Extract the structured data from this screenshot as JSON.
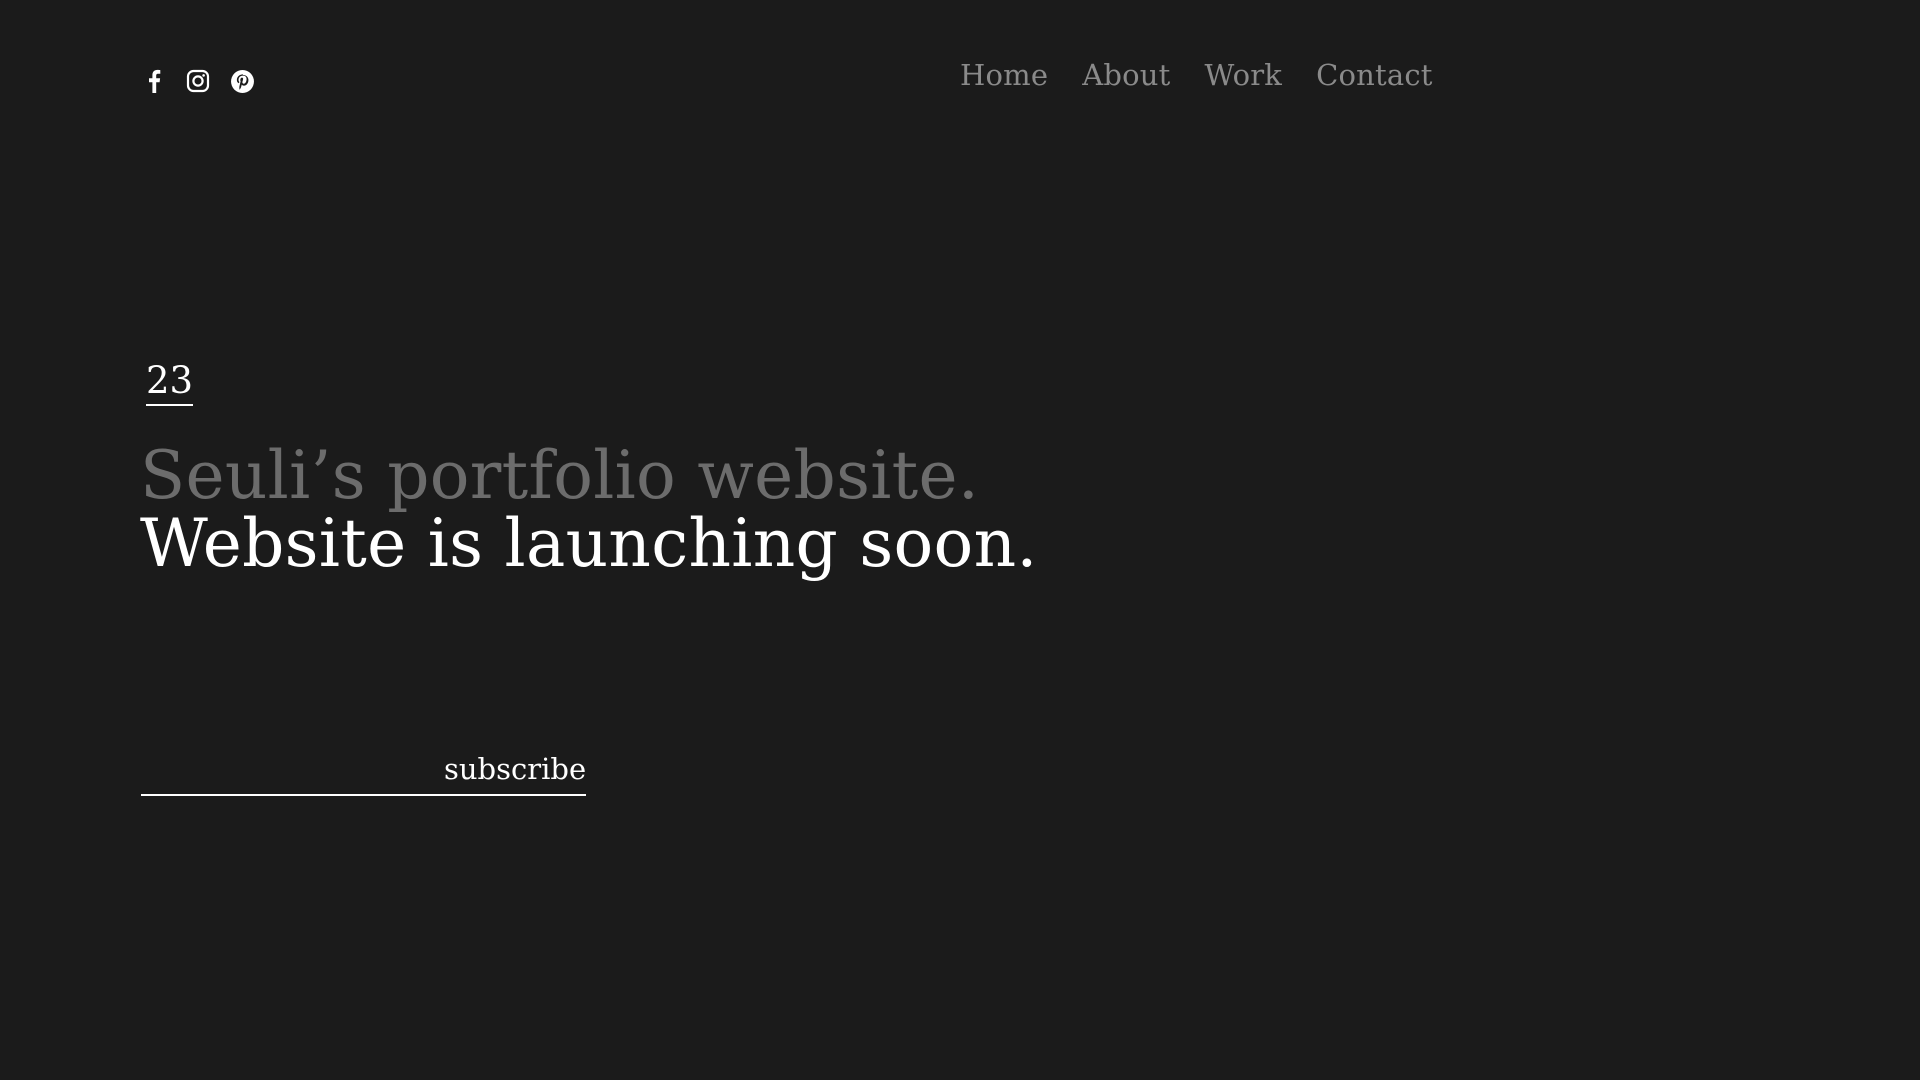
{
  "header": {
    "social_icons": [
      "facebook-icon",
      "instagram-icon",
      "pinterest-icon"
    ],
    "nav": [
      {
        "label": "Home"
      },
      {
        "label": "About"
      },
      {
        "label": "Work"
      },
      {
        "label": "Contact"
      }
    ]
  },
  "hero": {
    "counter": "23",
    "headline_line1": "Seuli’s portfolio website.",
    "headline_line2": "Website is launching soon."
  },
  "subscribe": {
    "input_value": "",
    "button_label": "subscribe"
  },
  "colors": {
    "background": "#1b1b1b",
    "text_primary": "#ffffff",
    "text_muted": "#6c6c6c",
    "nav_text": "#8a8a8a"
  }
}
